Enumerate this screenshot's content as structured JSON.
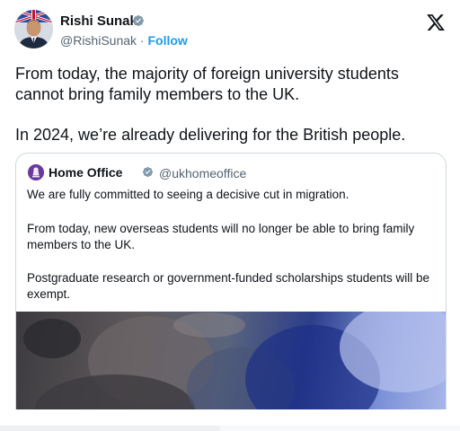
{
  "author": {
    "name": "Rishi Sunak",
    "handle": "@RishiSunak",
    "separator": "·",
    "follow_label": "Follow"
  },
  "tweet": {
    "paragraph_1": "From today, the majority of foreign university students cannot bring family members to the UK.",
    "paragraph_2": "In 2024, we’re already delivering for the British people."
  },
  "quoted_tweet": {
    "name": "Home Office",
    "handle": "@ukhomeoffice",
    "paragraph_1": "We are fully committed to seeing a decisive cut in migration.",
    "paragraph_2": "From today, new overseas students will no longer be able to bring family members to the UK.",
    "paragraph_3": "Postgraduate research or government-funded scholarships students will be exempt."
  },
  "icons": {
    "verified": "verified-badge-icon",
    "platform_logo": "x-logo-icon"
  },
  "colors": {
    "link": "#1d9bf0",
    "secondary_text": "#536471",
    "primary_text": "#0f1419",
    "verified_badge": "#829aab",
    "border": "#cfd9de"
  }
}
